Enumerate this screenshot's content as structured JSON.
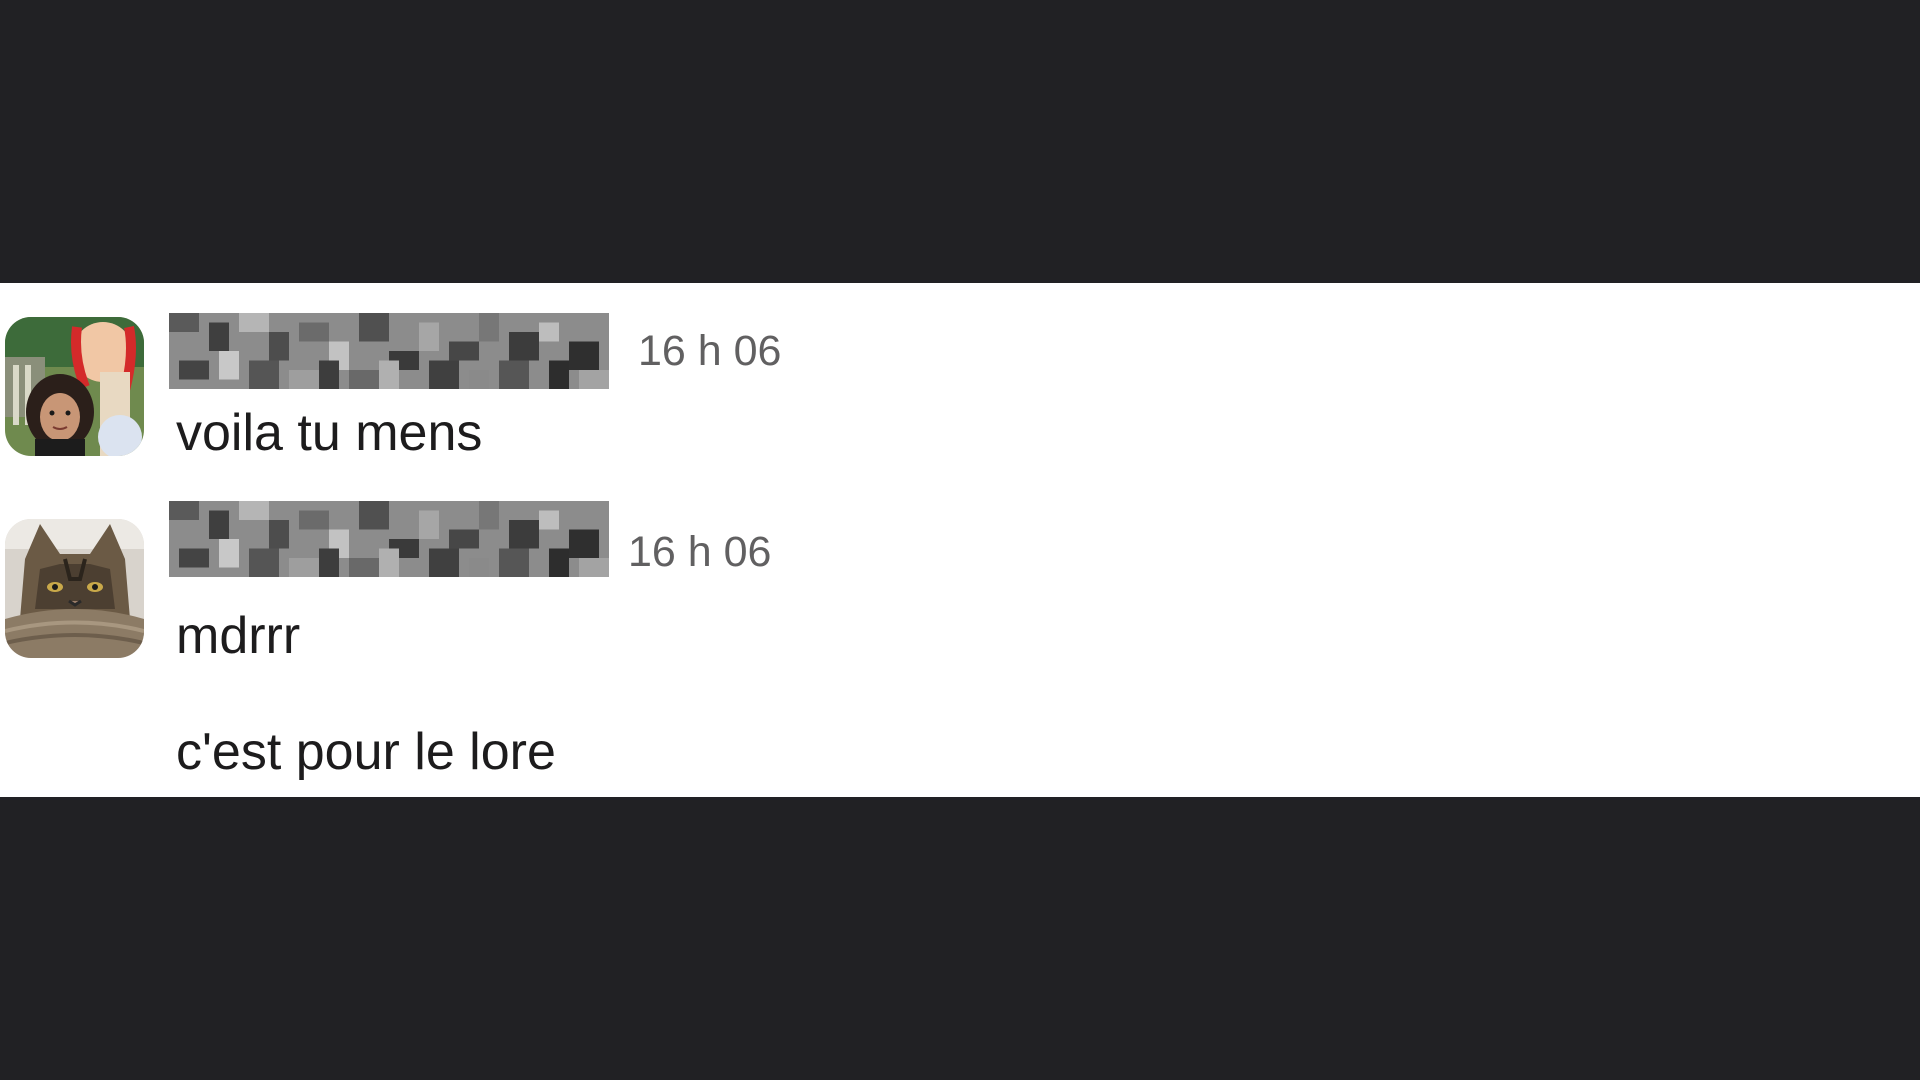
{
  "messages": [
    {
      "author": "",
      "time": "16 h 06",
      "lines": [
        "voila tu mens"
      ]
    },
    {
      "author": "",
      "time": "16 h 06",
      "lines": [
        "mdrrr",
        "c'est pour le lore"
      ]
    }
  ],
  "avatars": [
    "user-photo-avatar",
    "cat-photo-avatar"
  ],
  "colors": {
    "background": "#212124",
    "panel": "#ffffff",
    "text": "#1d1c1d",
    "timestamp": "#616061"
  }
}
